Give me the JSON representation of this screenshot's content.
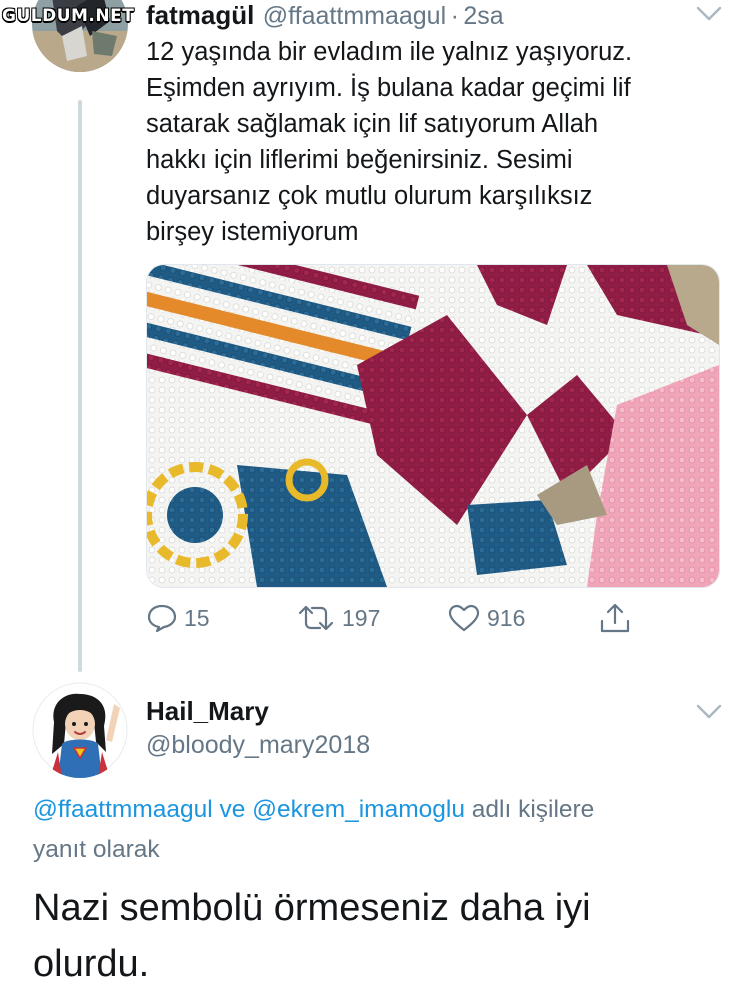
{
  "watermark": "GULDUM.NET",
  "original_tweet": {
    "display_name": "fatmagül",
    "handle": "@ffaattmmaagul",
    "separator": "·",
    "time": "2sa",
    "text": "12 yaşında bir evladım ile yalnız yaşıyoruz.\nEşimden ayrıyım. İş bulana kadar geçimi lif\nsatarak sağlamak için lif satıyorum Allah\nhakkı için liflerimi beğenirsiniz. Sesimi\nduyarsanız çok mutlu olurum karşılıksız\nbirşey istemiyorum",
    "actions": {
      "replies": "15",
      "retweets": "197",
      "likes": "916"
    },
    "icons": [
      "comment-icon",
      "retweet-icon",
      "heart-icon",
      "share-icon",
      "chevron-down-icon"
    ]
  },
  "reply_tweet": {
    "display_name": "Hail_Mary",
    "handle": "@bloody_mary2018",
    "replying_to": {
      "mention_1": "@ffaattmmaagul",
      "conjunction": " ve ",
      "mention_2": "@ekrem_imamoglu",
      "suffix_line1": " adlı kişilere",
      "suffix_line2": "yanıt olarak"
    },
    "text_line1": "Nazi sembolü örmeseniz daha iyi",
    "text_line2": "olurdu."
  },
  "colors": {
    "text": "#14171a",
    "muted": "#657786",
    "link": "#1b95e0",
    "thread_line": "#cfd9de"
  }
}
